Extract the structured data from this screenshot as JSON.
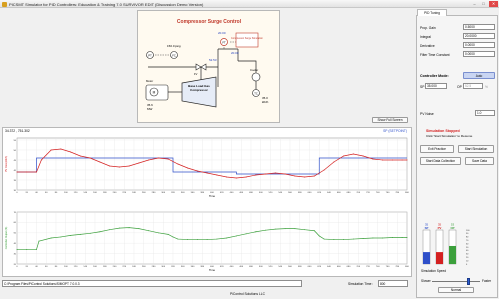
{
  "window": {
    "title": "PICSMT Simulator for PID Controllers: Education & Training 7.0 SURVIVOR EDIT (Discussion Demo Version)",
    "minimize": "–",
    "maximize": "□",
    "close": "✕"
  },
  "process": {
    "title": "Compressor Surge Control",
    "surge_label": "Compressor Surge Simulation",
    "pt_label": "PT",
    "fc_label": "FC",
    "fv_label": "FV",
    "ft_label": "FT",
    "gas_pressure": "150.0",
    "gas_unit": "psig",
    "flow_top": "20.00",
    "flow_mid": "20.00",
    "valve_pct": "52.53",
    "cooler_label": "Cooler",
    "tc_label": "TC",
    "tc_value": "35.0",
    "tc_unit": "klb/h",
    "motor_label": "Motor",
    "motor_value": "35.6",
    "motor_unit": "MW",
    "m_label": "M",
    "compressor_label": "Base Load Gas Compressor"
  },
  "show_full_screen": "Show Full Screen",
  "trend": {
    "readout_left": "34.372 , 751.302",
    "readout_right": "SP (SETPOINT)",
    "pv_axis_label": "PV Flow (klb/h)",
    "op_axis_label": "Controller Output (%)",
    "x_label": "Time"
  },
  "chart_data": [
    {
      "type": "line",
      "title": "",
      "xlabel": "Time",
      "ylabel": "PV Flow (klb/h)",
      "xlim": [
        0,
        800
      ],
      "ylim": [
        30,
        56
      ],
      "x_ticks": [
        0,
        20,
        40,
        60,
        80,
        100,
        120,
        140,
        160,
        180,
        200,
        220,
        240,
        260,
        280,
        300,
        320,
        340,
        360,
        380,
        400,
        420,
        440,
        460,
        480,
        500,
        520,
        540,
        560,
        580,
        600,
        620,
        640,
        660,
        680,
        700,
        720,
        740,
        760,
        780,
        800
      ],
      "y_ticks": [
        30,
        35,
        40,
        45,
        50,
        55
      ],
      "grid": true,
      "series": [
        {
          "name": "SP (SETPOINT)",
          "color": "#2e4fc9",
          "x": [
            0,
            40,
            40,
            320,
            320,
            450,
            450,
            620,
            620,
            800
          ],
          "y": [
            39,
            39,
            46,
            46,
            39,
            39,
            38,
            38,
            46,
            46
          ]
        },
        {
          "name": "PV",
          "color": "#d42020",
          "x": [
            0,
            20,
            40,
            50,
            70,
            90,
            110,
            130,
            150,
            170,
            190,
            210,
            230,
            250,
            270,
            290,
            310,
            330,
            350,
            370,
            390,
            410,
            430,
            450,
            470,
            490,
            510,
            530,
            550,
            570,
            590,
            610,
            630,
            650,
            670,
            690,
            710,
            730,
            750,
            770,
            790,
            800
          ],
          "y": [
            39,
            39,
            39,
            45,
            50,
            50.5,
            49,
            47,
            46,
            44,
            42,
            41.5,
            42,
            43.5,
            45,
            46,
            45.5,
            43,
            41,
            39.5,
            38.5,
            37.5,
            36.5,
            36,
            36.5,
            37.5,
            38,
            38.5,
            38,
            37,
            36.5,
            37,
            40,
            44,
            47,
            48,
            47,
            45.5,
            45,
            45,
            45,
            45
          ]
        }
      ]
    },
    {
      "type": "line",
      "title": "",
      "xlabel": "Time",
      "ylabel": "Controller Output (%)",
      "xlim": [
        0,
        800
      ],
      "ylim": [
        20,
        70
      ],
      "x_ticks": [
        0,
        20,
        40,
        60,
        80,
        100,
        120,
        140,
        160,
        180,
        200,
        220,
        240,
        260,
        280,
        300,
        320,
        340,
        360,
        380,
        400,
        420,
        440,
        460,
        480,
        500,
        520,
        540,
        560,
        580,
        600,
        620,
        640,
        660,
        680,
        700,
        720,
        740,
        760,
        780,
        800
      ],
      "y_ticks": [
        20,
        30,
        40,
        50,
        60,
        70
      ],
      "grid": true,
      "series": [
        {
          "name": "CO",
          "color": "#3ca03c",
          "x": [
            0,
            20,
            40,
            45,
            70,
            90,
            110,
            130,
            150,
            170,
            190,
            210,
            230,
            250,
            270,
            290,
            310,
            320,
            330,
            350,
            370,
            390,
            410,
            430,
            450,
            470,
            490,
            510,
            530,
            550,
            570,
            590,
            610,
            620,
            630,
            650,
            670,
            690,
            710,
            730,
            750,
            770,
            790,
            800
          ],
          "y": [
            34,
            34,
            34,
            42,
            45,
            46,
            47.5,
            48.5,
            49.5,
            51,
            53,
            54.5,
            55,
            54,
            52,
            50,
            48.5,
            46,
            44,
            43.5,
            43.5,
            43.5,
            44,
            45,
            47,
            49,
            51,
            52.5,
            53.5,
            54,
            54,
            53,
            52,
            47,
            44,
            43.5,
            43.5,
            44,
            44.5,
            45,
            45,
            45.5,
            45.5,
            45.5
          ]
        }
      ]
    }
  ],
  "path_text": "C:\\Program Files\\PiControl Solutions\\SIMOPT 7.0.0.3",
  "sim_time_label": "Simulation Time :",
  "sim_time_value": "800",
  "footer": "PiControl Solutions LLC",
  "tab": "PID Tuning",
  "params": [
    {
      "label": "Prop. Gain",
      "value": "0.5000"
    },
    {
      "label": "Integral",
      "value": "20.0000"
    },
    {
      "label": "Derivative",
      "value": "0.0000"
    },
    {
      "label": "Filter Time Constant",
      "value": "0.0000"
    }
  ],
  "controller_mode_label": "Controller Mode:",
  "controller_mode_value": "Auto",
  "sp_label": "SP",
  "sp_value": "35.000",
  "op_label": "OP",
  "op_value": "52.5",
  "op_unit": "%",
  "pv_noise_label": "PV Noise",
  "pv_noise_value": "1.0",
  "sim_stopped": "Simulation Stopped",
  "sim_hint": "Click 'Start Simulation' to Resume",
  "buttons": {
    "exit_practice": "Exit Practice",
    "start_simulation": "Start Simulation",
    "start_data_collection": "Start Data Collection",
    "save_data": "Save Data"
  },
  "bars": [
    {
      "label": "SP",
      "value": "35",
      "level": 0.35,
      "color": "#2e4fc9"
    },
    {
      "label": "PV",
      "value": "35",
      "level": 0.35,
      "color": "#d42020"
    },
    {
      "label": "OP",
      "value": "53",
      "level": 0.53,
      "color": "#3ca03c"
    }
  ],
  "bar_ticks": [
    "100",
    "90",
    "80",
    "70",
    "60",
    "50",
    "40",
    "30",
    "20",
    "10",
    "0"
  ],
  "speed": {
    "label": "Simulation Speed",
    "slower": "Slower",
    "faster": "Faster",
    "value": "Normal",
    "level": 0.72
  }
}
